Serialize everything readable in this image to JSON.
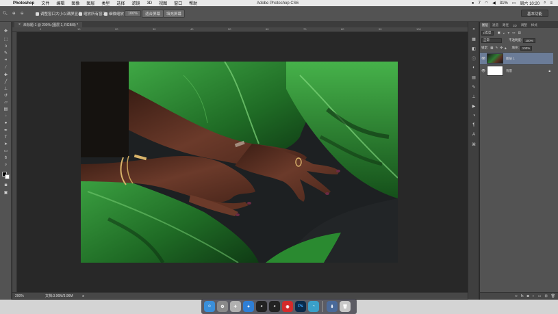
{
  "menubar": {
    "app_name": "Photoshop",
    "menus": [
      "文件",
      "编辑",
      "图像",
      "图层",
      "类型",
      "选择",
      "滤镜",
      "3D",
      "视图",
      "窗口",
      "帮助"
    ],
    "window_title": "Adobe Photoshop CS6",
    "battery": "31%",
    "clock": "周六 10:20",
    "notif_count": "7"
  },
  "options_bar": {
    "opt_resize_label": "调整窗口大小以满屏显示",
    "opt_zoom_all_label": "缩放所有窗口",
    "opt_scrubby_label": "细微缩放",
    "zoom_button": "100%",
    "fit_screen_button": "适合屏幕",
    "fill_screen_button": "填充屏幕",
    "workspace": "基本功能"
  },
  "document": {
    "tab_title": "未标题-1 @ 200% (图层 1, RGB/8) *",
    "ruler_marks": [
      "0",
      "10",
      "20",
      "30",
      "40",
      "50",
      "60",
      "70",
      "80",
      "90",
      "100"
    ],
    "status_zoom": "200%",
    "status_doc": "文档:3.96M/3.96M"
  },
  "panels": {
    "tabs": [
      "图层",
      "通道",
      "路径",
      "3D",
      "调整",
      "样式"
    ],
    "active_tab": "图层",
    "kind_label": "ρ类型",
    "blend_mode": "正常",
    "opacity_label": "不透明度:",
    "opacity_value": "100%",
    "lock_label": "锁定:",
    "fill_label": "填充:",
    "fill_value": "100%",
    "layers": [
      {
        "name": "图层 1",
        "selected": true
      },
      {
        "name": "背景",
        "selected": false
      }
    ],
    "bottom_icons": [
      "link-icon",
      "fx-icon",
      "mask-icon",
      "adjust-icon",
      "folder-icon",
      "new-layer-icon",
      "trash-icon"
    ]
  },
  "dock": {
    "apps": [
      {
        "icon": "finder-icon",
        "color": "#3a8fd9",
        "label": ""
      },
      {
        "icon": "system-preferences-icon",
        "color": "#8a8a8a",
        "label": ""
      },
      {
        "icon": "launchpad-icon",
        "color": "#b0b0b0",
        "label": ""
      },
      {
        "icon": "safari-icon",
        "color": "#2e7fd6",
        "label": ""
      },
      {
        "icon": "qq-icon",
        "color": "#222222",
        "label": ""
      },
      {
        "icon": "qq-icon-2",
        "color": "#222222",
        "label": ""
      },
      {
        "icon": "netease-music-icon",
        "color": "#d32b2b",
        "label": ""
      },
      {
        "icon": "photoshop-icon",
        "color": "#0a2a4a",
        "label": "Ps"
      },
      {
        "icon": "qq-browser-icon",
        "color": "#3aa0c9",
        "label": ""
      },
      {
        "icon": "downloads-icon",
        "color": "#4a6a9a",
        "label": ""
      },
      {
        "icon": "trash-icon",
        "color": "#c8c8c8",
        "label": ""
      }
    ]
  }
}
